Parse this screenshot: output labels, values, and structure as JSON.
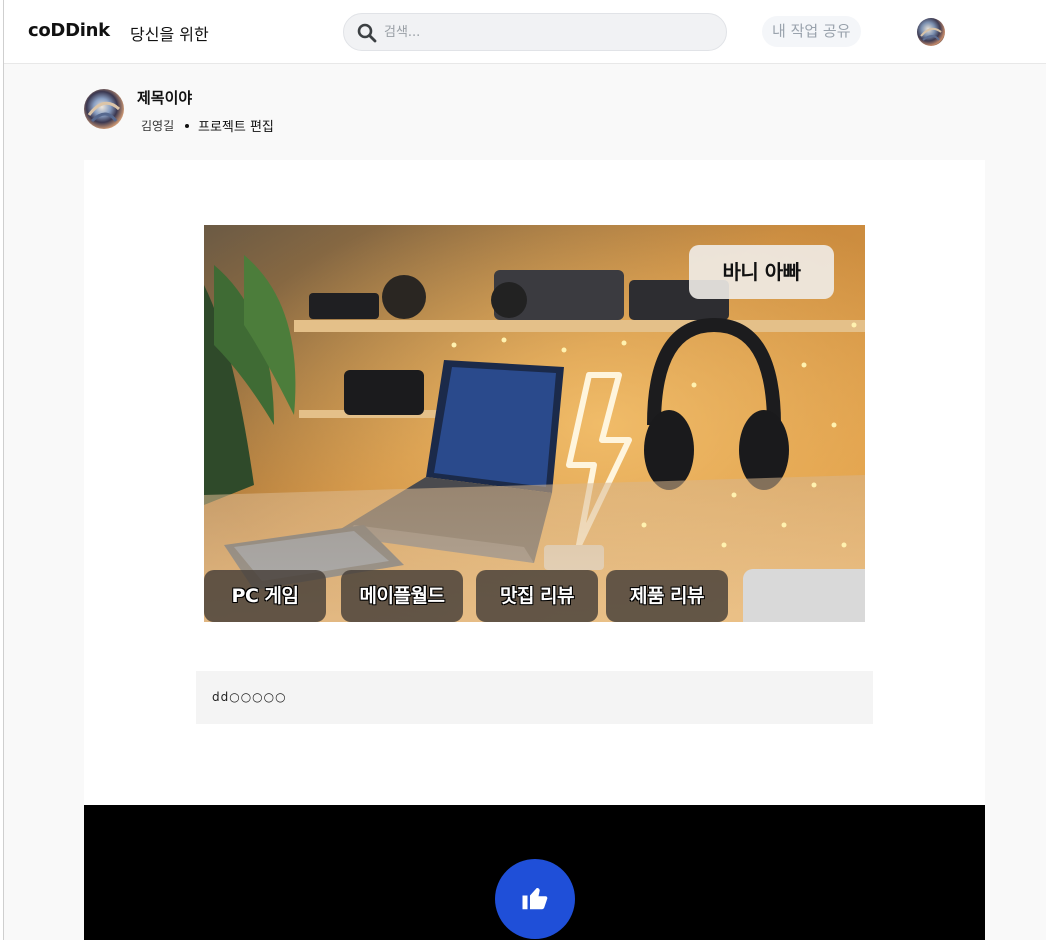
{
  "header": {
    "logo": "coDDink",
    "nav_foryou": "당신을 위한",
    "search_placeholder": "검색...",
    "share_label": "내 작업 공유"
  },
  "project": {
    "title": "제목이야",
    "author": "김영길",
    "edit_label": "프로젝트 편집"
  },
  "hero": {
    "top_tag": "바니 아빠",
    "tags": [
      "PC 게임",
      "메이플월드",
      "맛집 리뷰",
      "제품 리뷰"
    ]
  },
  "description": "dd○○○○○",
  "colors": {
    "like_button": "#1f4fd8",
    "share_text": "#9aa3ad"
  },
  "icons": {
    "search": "search-icon",
    "like": "thumbs-up-icon"
  }
}
